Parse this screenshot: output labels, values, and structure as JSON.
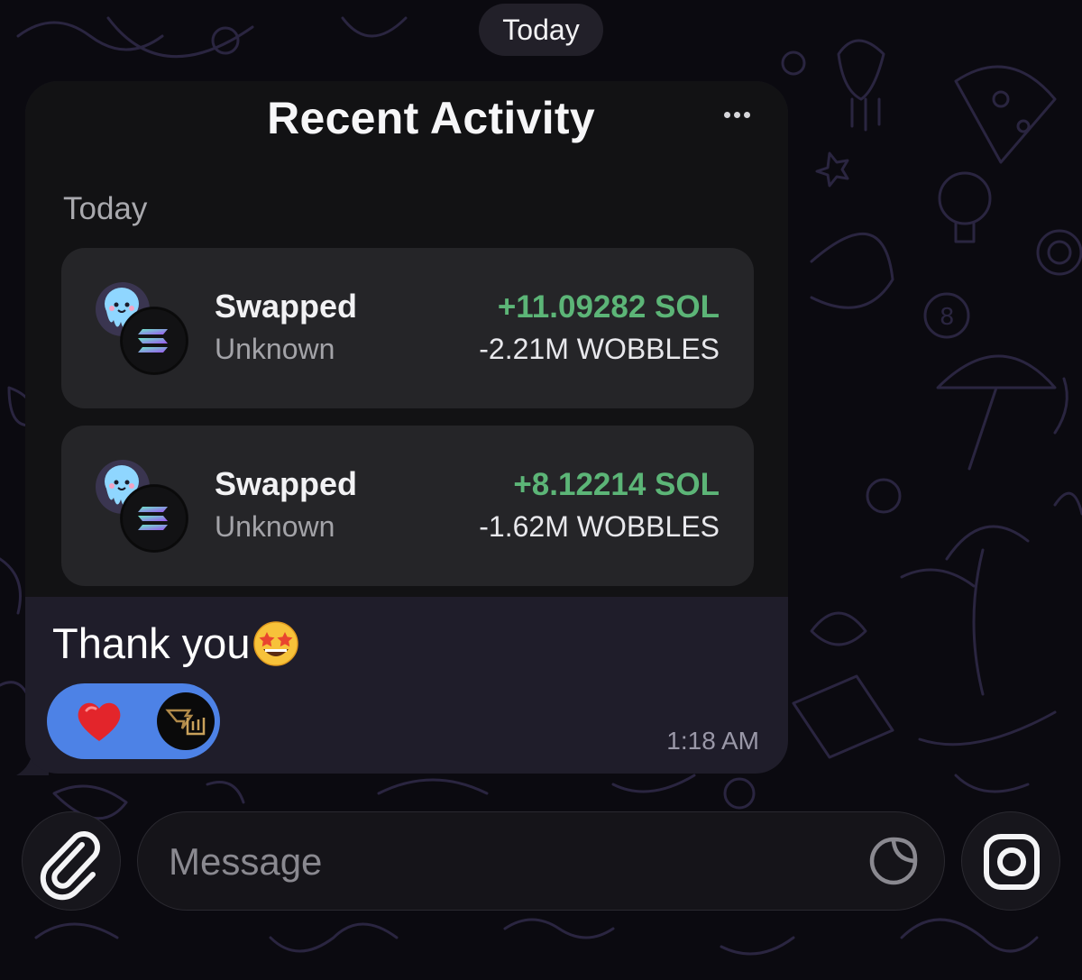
{
  "chat": {
    "date_separator": "Today"
  },
  "activity_card": {
    "title": "Recent Activity",
    "section_label": "Today",
    "transactions": [
      {
        "title": "Swapped",
        "subtitle": "Unknown",
        "amount_in": "+11.09282 SOL",
        "amount_out": "-2.21M WOBBLES"
      },
      {
        "title": "Swapped",
        "subtitle": "Unknown",
        "amount_in": "+8.12214 SOL",
        "amount_out": "-1.62M WOBBLES"
      }
    ]
  },
  "message": {
    "text": "Thank you",
    "emoji": "star-struck-emoji",
    "time": "1:18 AM",
    "reaction": {
      "emoji": "heart",
      "count_avatars": 1
    }
  },
  "composer": {
    "placeholder": "Message"
  },
  "colors": {
    "background": "#0b0a10",
    "bubble": "#1f1d2a",
    "card": "#121214",
    "row": "#252528",
    "positive_amount": "#5cb577",
    "reaction_pill": "#4d82e6"
  }
}
